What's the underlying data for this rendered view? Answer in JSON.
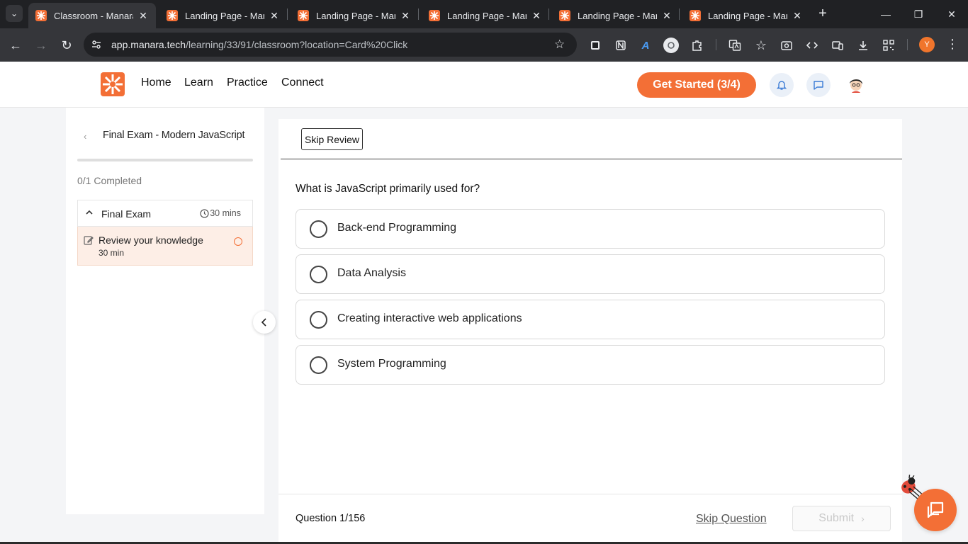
{
  "browser": {
    "tabs": [
      {
        "title": "Classroom - Manara",
        "active": true
      },
      {
        "title": "Landing Page - Manara",
        "active": false
      },
      {
        "title": "Landing Page - Manara",
        "active": false
      },
      {
        "title": "Landing Page - Manara",
        "active": false
      },
      {
        "title": "Landing Page - Manara",
        "active": false
      },
      {
        "title": "Landing Page - Manara",
        "active": false
      }
    ],
    "url_host": "app.manara.tech",
    "url_path": "/learning/33/91/classroom?location=Card%20Click",
    "profile_initial": "Y",
    "accent": "#f36f36"
  },
  "header": {
    "nav": [
      "Home",
      "Learn",
      "Practice",
      "Connect"
    ],
    "cta_label": "Get Started (3/4)"
  },
  "sidebar": {
    "course_title": "Final Exam - Modern JavaScript",
    "progress_fraction": 0,
    "completed_label": "0/1 Completed",
    "section": {
      "title": "Final Exam",
      "duration": "30 mins"
    },
    "lesson": {
      "title": "Review your knowledge",
      "duration": "30 min"
    }
  },
  "quiz": {
    "skip_review_label": "Skip Review",
    "question": "What is JavaScript primarily used for?",
    "options": [
      "Back-end Programming",
      "Data Analysis",
      "Creating interactive web applications",
      "System Programming"
    ],
    "question_counter": "Question 1/156",
    "skip_question_label": "Skip Question",
    "submit_label": "Submit"
  }
}
